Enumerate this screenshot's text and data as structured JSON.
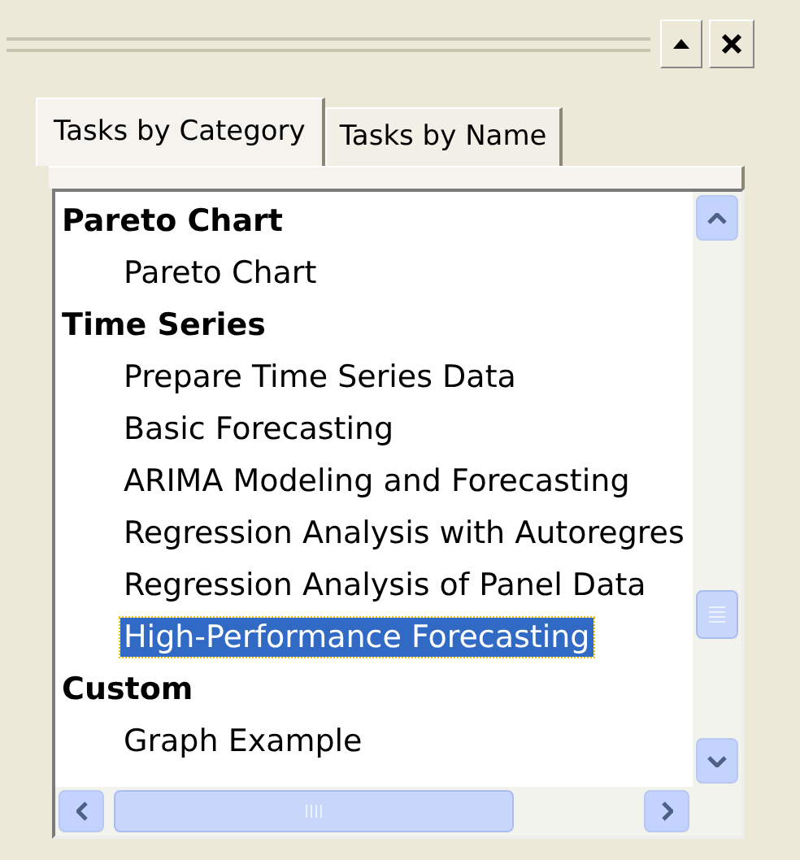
{
  "tabs": [
    {
      "label": "Tasks by Category",
      "selected": true
    },
    {
      "label": "Tasks by Name",
      "selected": false
    }
  ],
  "tree": [
    {
      "label": "Pareto Chart",
      "selected": false,
      "children": [
        {
          "label": "Pareto Chart",
          "selected": false
        }
      ]
    },
    {
      "label": "Time Series",
      "selected": false,
      "children": [
        {
          "label": "Prepare Time Series Data",
          "selected": false
        },
        {
          "label": "Basic Forecasting",
          "selected": false
        },
        {
          "label": "ARIMA Modeling and Forecasting",
          "selected": false
        },
        {
          "label": "Regression Analysis with Autoregres",
          "selected": false
        },
        {
          "label": "Regression Analysis of Panel Data",
          "selected": false
        },
        {
          "label": "High-Performance Forecasting",
          "selected": true
        }
      ]
    },
    {
      "label": "Custom",
      "selected": false,
      "children": [
        {
          "label": "Graph Example",
          "selected": false
        }
      ]
    }
  ]
}
